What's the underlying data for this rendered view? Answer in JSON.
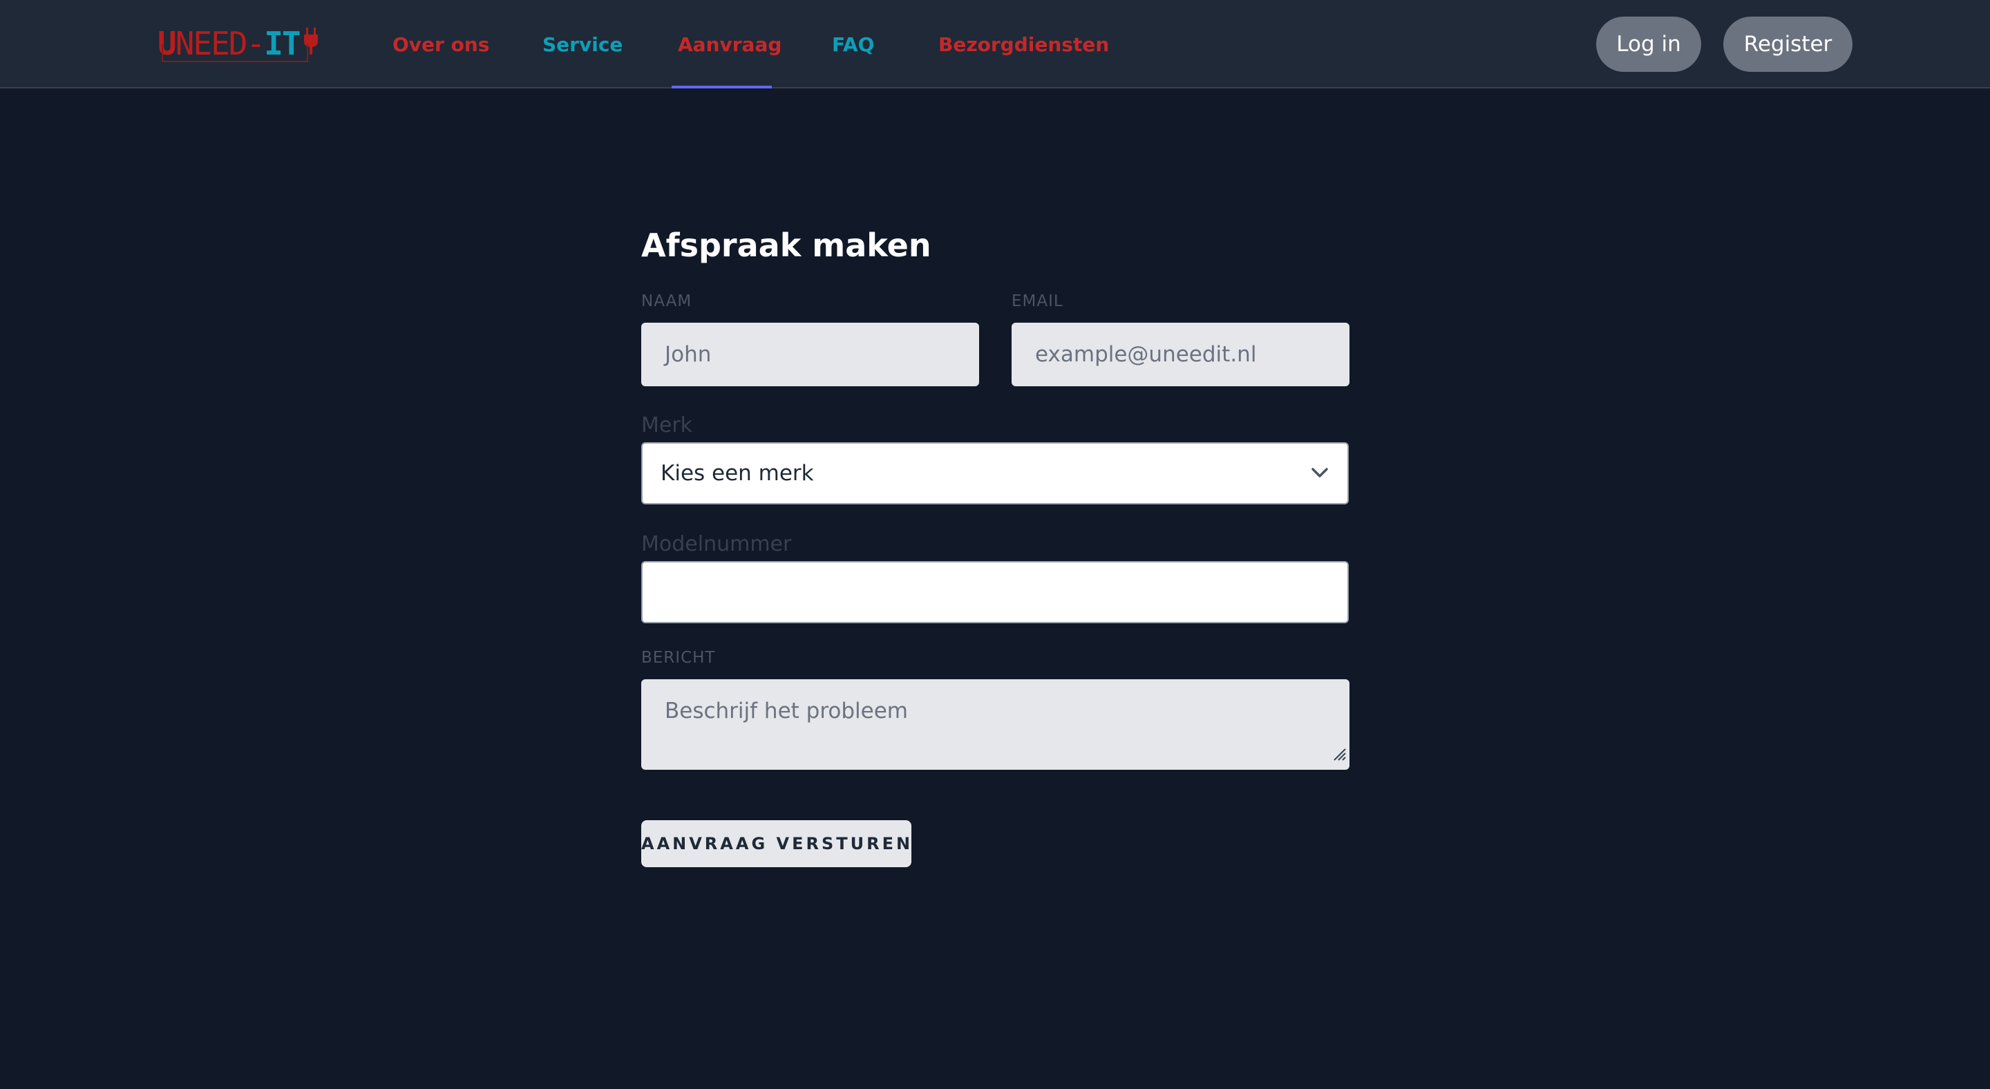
{
  "brand": {
    "logo_u": "U",
    "logo_mid": "NEED-",
    "logo_it": "IT",
    "colors": {
      "red": "#c62828",
      "teal": "#0e9fb8",
      "background": "#111827",
      "nav": "#1f2937",
      "active_underline": "#6366f1"
    }
  },
  "nav": {
    "links": [
      {
        "label": "Over ons"
      },
      {
        "label": "Service"
      },
      {
        "label": "Aanvraag",
        "active": true
      },
      {
        "label": "FAQ"
      },
      {
        "label": "Bezorgdiensten"
      }
    ],
    "login_label": "Log in",
    "register_label": "Register"
  },
  "form": {
    "title": "Afspraak maken",
    "name": {
      "label": "NAAM",
      "placeholder": "John"
    },
    "email": {
      "label": "EMAIL",
      "placeholder": "example@uneedit.nl"
    },
    "brand_select": {
      "label": "Merk",
      "value": "Kies een merk"
    },
    "model": {
      "label": "Modelnummer",
      "value": ""
    },
    "message": {
      "label": "BERICHT",
      "placeholder": "Beschrijf het probleem"
    },
    "submit_label": "AANVRAAG VERSTUREN"
  },
  "icons": {
    "logo_plug": "plug-icon",
    "select_chevron": "chevron-down-icon",
    "textarea_resize": "resize-grip-icon"
  }
}
